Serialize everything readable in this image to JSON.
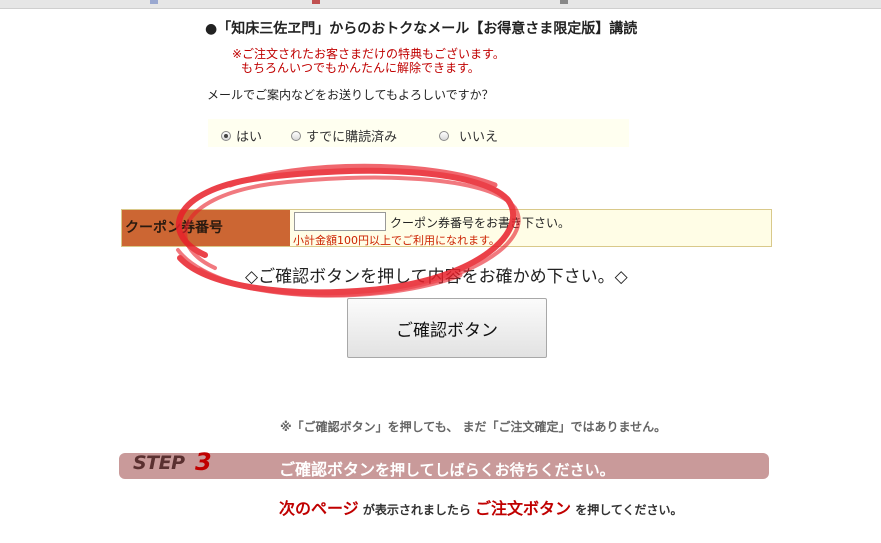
{
  "colors": {
    "accent_red": "#c00000",
    "coupon_label_bg": "#cc6633",
    "coupon_row_bg": "#fffde6",
    "radio_bg": "#fffff0",
    "step_bar_bg": "#c99a9a",
    "annotation_red": "#e8202a"
  },
  "newsletter": {
    "title": "●「知床三佐ヱ門」からのおトクなメール【お得意さま限定版】講読",
    "notice_line1": "※ご注文されたお客さまだけの特典もございます。",
    "notice_line2": "もちろんいつでもかんたんに解除できます。",
    "question": "メールでご案内などをお送りしてもよろしいですか？",
    "options": [
      {
        "label": "はい",
        "selected": true
      },
      {
        "label": "すでに購読済み",
        "selected": false
      },
      {
        "label": "いいえ",
        "selected": false
      }
    ]
  },
  "coupon": {
    "label": "クーポン券番号",
    "input_value": "",
    "hint": "クーポン券番号をお書き下さい。",
    "note": "小計金額100円以上でご利用になれます。"
  },
  "confirm": {
    "instruction": "◇ご確認ボタンを押して内容をお確かめ下さい。◇",
    "button_label": "ご確認ボタン"
  },
  "disclaimer": "※「ご確認ボタン」を押しても、 まだ「ご注文確定」ではありません。",
  "step": {
    "label": "STEP",
    "number": "3",
    "message_part1": "ご確認ボタン",
    "message_part2": "を押してしばらくお待ちください。"
  },
  "next_page": {
    "part1": "次のページ",
    "part2": " が表示されましたら ",
    "part3": "ご注文ボタン",
    "part4": " を押してください。"
  },
  "annotation": {
    "icon": "hand-drawn-red-circle-icon"
  }
}
